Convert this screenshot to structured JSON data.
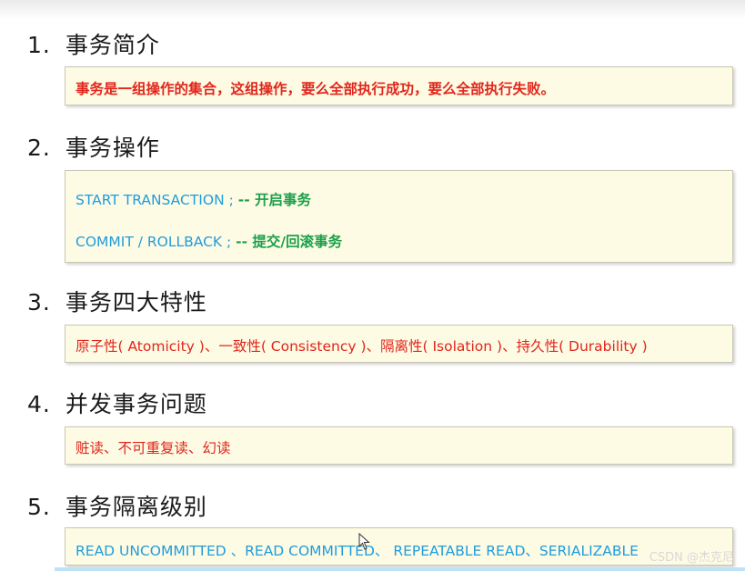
{
  "sections": [
    {
      "num": "1.",
      "title": "事务简介",
      "lines": [
        {
          "text": "事务是一组操作的集合，这组操作，要么全部执行成功，要么全部执行失败。"
        }
      ]
    },
    {
      "num": "2.",
      "title": "事务操作",
      "lines": [
        {
          "code": "START TRANSACTION ;",
          "comment": "-- 开启事务"
        },
        {
          "code": "COMMIT / ROLLBACK ;",
          "comment": "-- 提交/回滚事务"
        }
      ]
    },
    {
      "num": "3.",
      "title": "事务四大特性",
      "lines": [
        {
          "text": "原子性( Atomicity )、一致性( Consistency )、隔离性( Isolation )、持久性( Durability )"
        }
      ]
    },
    {
      "num": "4.",
      "title": "并发事务问题",
      "lines": [
        {
          "text": "赃读、不可重复读、幻读"
        }
      ]
    },
    {
      "num": "5.",
      "title": "事务隔离级别",
      "lines": [
        {
          "text": "READ UNCOMMITTED 、READ COMMITTED、 REPEATABLE READ、SERIALIZABLE"
        }
      ]
    }
  ],
  "watermark": "CSDN @杰克尼",
  "colors": {
    "box_bg": "#fefbe4",
    "red": "#e1261c",
    "blue": "#1f9ddc",
    "green": "#1aa04a"
  }
}
